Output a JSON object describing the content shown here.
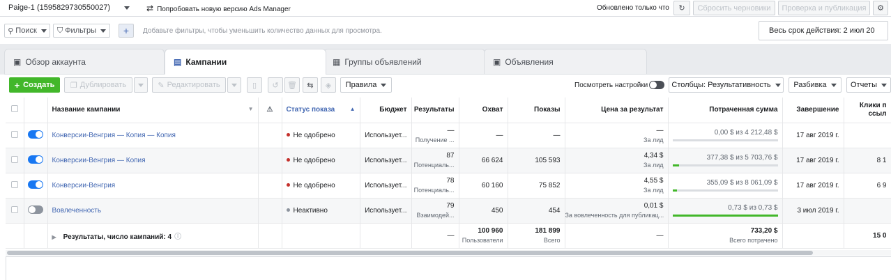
{
  "top": {
    "account": "Paige-1 (1595829730550027)",
    "try_new": "Попробовать новую версию Ads Manager",
    "updated": "Обновлено только что",
    "discard": "Сбросить черновики",
    "review": "Проверка и публикация"
  },
  "filterbar": {
    "search": "Поиск",
    "filters": "Фильтры",
    "hint": "Добавьте фильтры, чтобы уменьшить количество данных для просмотра.",
    "date": "Весь срок действия: 2 июл 20"
  },
  "tabs": [
    {
      "label": "Обзор аккаунта"
    },
    {
      "label": "Кампании"
    },
    {
      "label": "Группы объявлений"
    },
    {
      "label": "Объявления"
    }
  ],
  "toolbar": {
    "create": "Создать",
    "duplicate": "Дублировать",
    "edit": "Редактировать",
    "rules": "Правила",
    "view_settings": "Посмотреть настройки",
    "columns": "Столбцы: Результативность",
    "breakdown": "Разбивка",
    "reports": "Отчеты"
  },
  "headers": {
    "name": "Название кампании",
    "status": "Статус показа",
    "budget": "Бюджет",
    "results": "Результаты",
    "reach": "Охват",
    "impressions": "Показы",
    "cost": "Цена за результат",
    "spent": "Потраченная сумма",
    "end": "Завершение",
    "clicks": "Клики п ссыл"
  },
  "rows": [
    {
      "name": "Конверсии-Венгрия — Копия — Копия",
      "on": true,
      "status": "Не одобрено",
      "status_color": "#c4302b",
      "budget": "Использует...",
      "results": "—",
      "results_sub": "Получение ...",
      "reach": "—",
      "impressions": "—",
      "cost": "—",
      "cost_sub": "За лид",
      "spent": "0,00 $ из 4 212,48 $",
      "spent_frac": 0,
      "end": "17 авг 2019 г.",
      "clicks": ""
    },
    {
      "name": "Конверсии-Венгрия — Копия",
      "on": true,
      "status": "Не одобрено",
      "status_color": "#c4302b",
      "budget": "Использует...",
      "results": "87",
      "results_sub": "Потенциаль...",
      "reach": "66 624",
      "impressions": "105 593",
      "cost": "4,34 $",
      "cost_sub": "За лид",
      "spent": "377,38 $ из 5 703,76 $",
      "spent_frac": 0.066,
      "end": "17 авг 2019 г.",
      "clicks": "8 1"
    },
    {
      "name": "Конверсии-Венгрия",
      "on": true,
      "status": "Не одобрено",
      "status_color": "#c4302b",
      "budget": "Использует...",
      "results": "78",
      "results_sub": "Потенциаль...",
      "reach": "60 160",
      "impressions": "75 852",
      "cost": "4,55 $",
      "cost_sub": "За лид",
      "spent": "355,09 $ из 8 061,09 $",
      "spent_frac": 0.044,
      "end": "17 авг 2019 г.",
      "clicks": "6 9"
    },
    {
      "name": "Вовлеченность",
      "on": false,
      "status": "Неактивно",
      "status_color": "#8d949e",
      "budget": "Использует...",
      "results": "79",
      "results_sub": "Взаимодей...",
      "reach": "450",
      "impressions": "454",
      "cost": "0,01 $",
      "cost_sub": "За вовлеченность для публикац...",
      "spent": "0,73 $ из 0,73 $",
      "spent_frac": 1,
      "end": "3 июл 2019 г.",
      "clicks": ""
    }
  ],
  "totals": {
    "label": "Результаты, число кампаний: 4",
    "results": "—",
    "reach": "100 960",
    "reach_sub": "Пользователи",
    "impressions": "181 899",
    "impressions_sub": "Всего",
    "cost": "—",
    "spent": "733,20 $",
    "spent_sub": "Всего потрачено",
    "clicks": "15 0"
  }
}
